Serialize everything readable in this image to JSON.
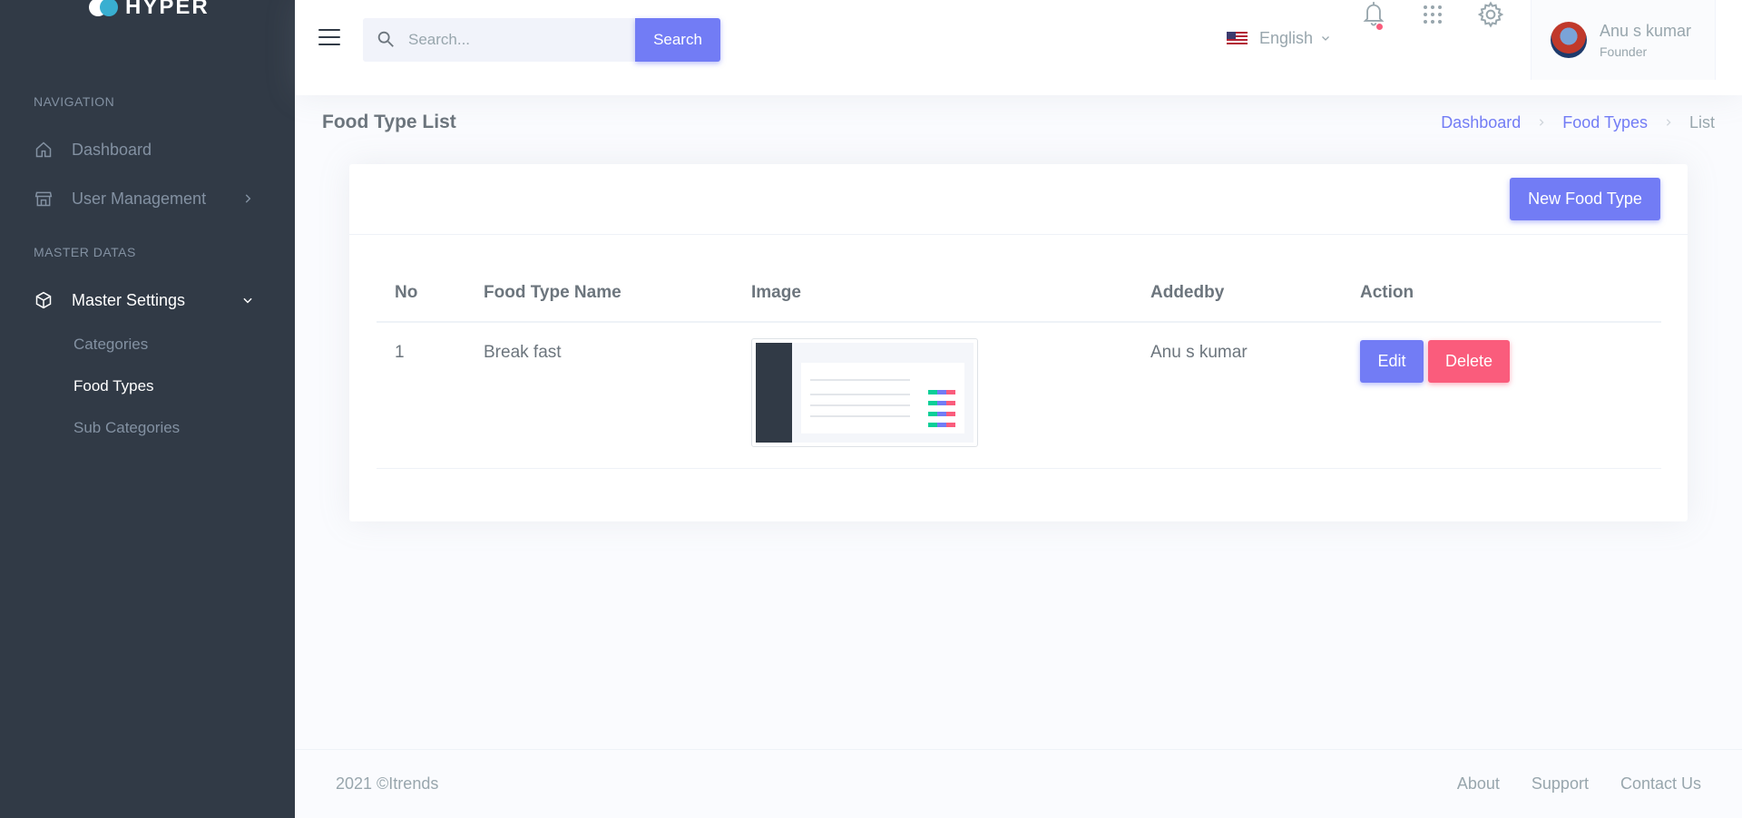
{
  "brand": {
    "name": "HYPER"
  },
  "sidebar": {
    "section_navigation": "NAVIGATION",
    "section_master": "MASTER DATAS",
    "items": [
      {
        "label": "Dashboard",
        "icon": "home-icon"
      },
      {
        "label": "User Management",
        "icon": "store-icon"
      },
      {
        "label": "Master Settings",
        "icon": "box-icon"
      }
    ],
    "sub_items": [
      {
        "label": "Categories"
      },
      {
        "label": "Food Types",
        "active": true
      },
      {
        "label": "Sub Categories"
      }
    ]
  },
  "topbar": {
    "search_placeholder": "Search...",
    "search_button": "Search",
    "language": "English",
    "user": {
      "name": "Anu s kumar",
      "role": "Founder"
    }
  },
  "page": {
    "title": "Food Type List",
    "breadcrumb": [
      "Dashboard",
      "Food Types",
      "List"
    ]
  },
  "card": {
    "new_button": "New Food Type",
    "table": {
      "columns": [
        "No",
        "Food Type Name",
        "Image",
        "Addedby",
        "Action"
      ],
      "rows": [
        {
          "no": "1",
          "name": "Break fast",
          "added_by": "Anu s kumar",
          "edit": "Edit",
          "delete": "Delete"
        }
      ]
    }
  },
  "footer": {
    "copyright": "2021 ©Itrends",
    "links": [
      "About",
      "Support",
      "Contact Us"
    ]
  },
  "colors": {
    "sidebar_bg": "#313a46",
    "primary": "#727cf5",
    "danger": "#fa5c7c",
    "success": "#0acf97",
    "page_bg": "#fafbfe"
  }
}
